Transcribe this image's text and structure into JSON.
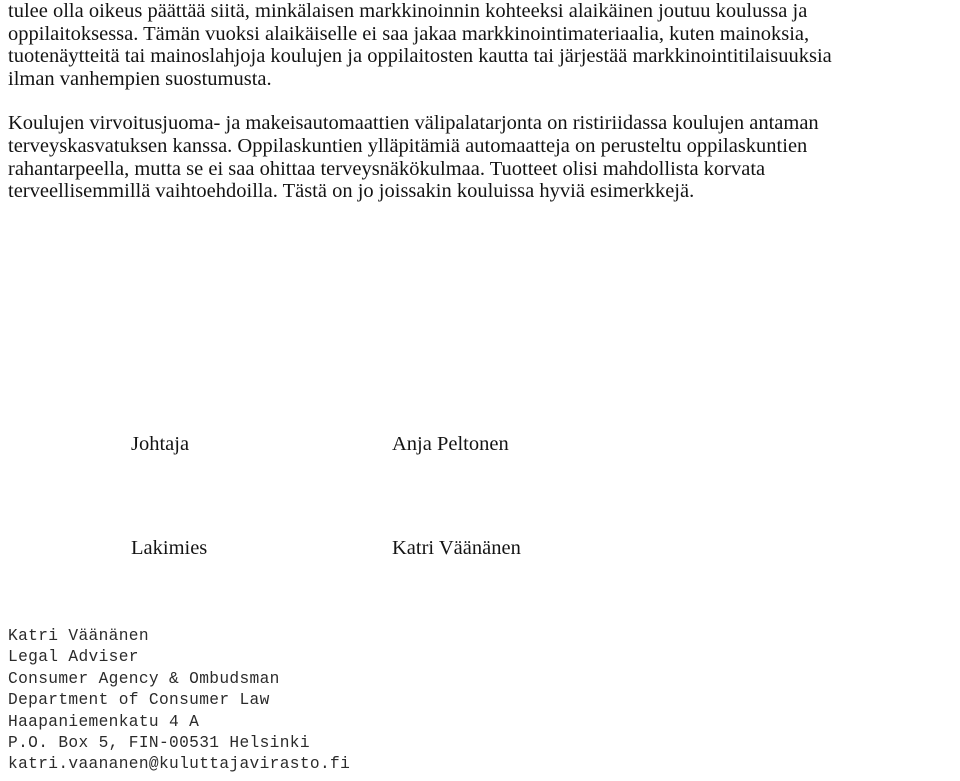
{
  "document": {
    "language": "fi",
    "background_color": "#ffffff",
    "text_color": "#131313",
    "footer_text_color": "#2b2b2b"
  },
  "body": {
    "paragraphs": [
      {
        "id": "paragraph-1",
        "lines": [
          "tulee olla oikeus päättää siitä, minkälaisen markkinoinnin kohteeksi alaikäinen joutuu koulussa ja",
          "oppilaitoksessa. Tämän vuoksi alaikäiselle ei saa jakaa markkinointimateriaalia, kuten mainoksia,",
          "tuotenäytteitä tai mainoslahjoja koulujen ja oppilaitosten kautta tai järjestää markkinointitilaisuuksia",
          "ilman vanhempien suostumusta."
        ]
      },
      {
        "id": "paragraph-2",
        "lines": [
          "Koulujen virvoitusjuoma- ja makeisautomaattien välipalatarjonta on ristiriidassa koulujen antaman",
          "terveyskasvatuksen kanssa. Oppilaskuntien ylläpitämiä automaatteja on perusteltu oppilaskuntien",
          "rahantarpeella, mutta se ei saa ohittaa terveysnäkökulmaa. Tuotteet olisi mahdollista korvata",
          "terveellisemmillä vaihtoehdoilla. Tästä on jo joissakin kouluissa hyviä esimerkkejä."
        ]
      }
    ]
  },
  "signatures": {
    "rows": [
      {
        "title": "Johtaja",
        "name": "Anja Peltonen"
      },
      {
        "title": "Lakimies",
        "name": "Katri Väänänen"
      }
    ]
  },
  "footer": {
    "lines": [
      "Katri Väänänen",
      "Legal Adviser",
      "Consumer Agency & Ombudsman",
      "Department of Consumer Law",
      "Haapaniemenkatu 4 A",
      "P.O. Box 5, FIN-00531 Helsinki",
      "katri.vaananen@kuluttajavirasto.fi"
    ]
  }
}
